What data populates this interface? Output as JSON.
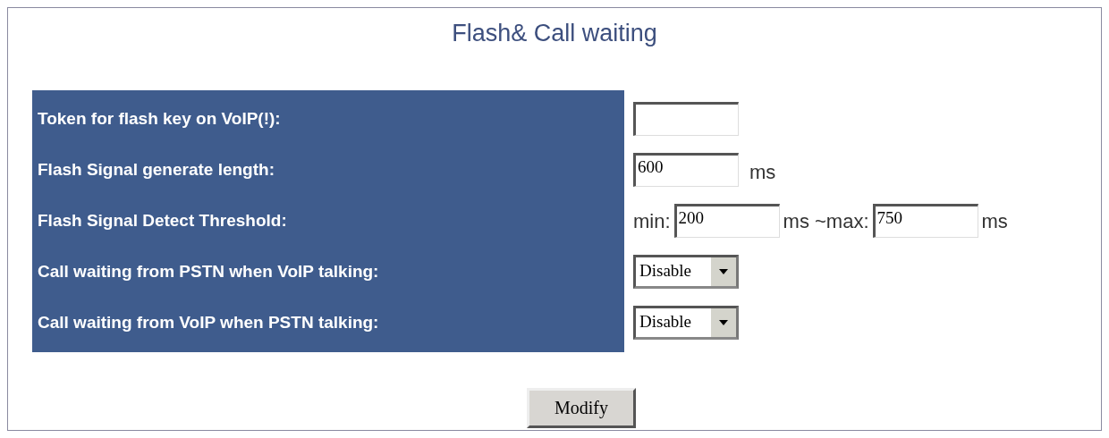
{
  "title": "Flash& Call waiting",
  "rows": [
    {
      "label": "Token for flash key on VoIP(!):",
      "kind": "text"
    },
    {
      "label": "Flash Signal generate length:",
      "kind": "text",
      "value": "600",
      "unit": "ms"
    },
    {
      "label": "Flash Signal Detect Threshold:",
      "kind": "range",
      "min_label": "min:",
      "min": "200",
      "separator": "ms ~max:",
      "max": "750",
      "unit": "ms"
    },
    {
      "label": "Call waiting from PSTN when VoIP talking:",
      "kind": "select",
      "value": "Disable"
    },
    {
      "label": "Call waiting from VoIP when PSTN talking:",
      "kind": "select",
      "value": "Disable"
    }
  ],
  "button": "Modify"
}
